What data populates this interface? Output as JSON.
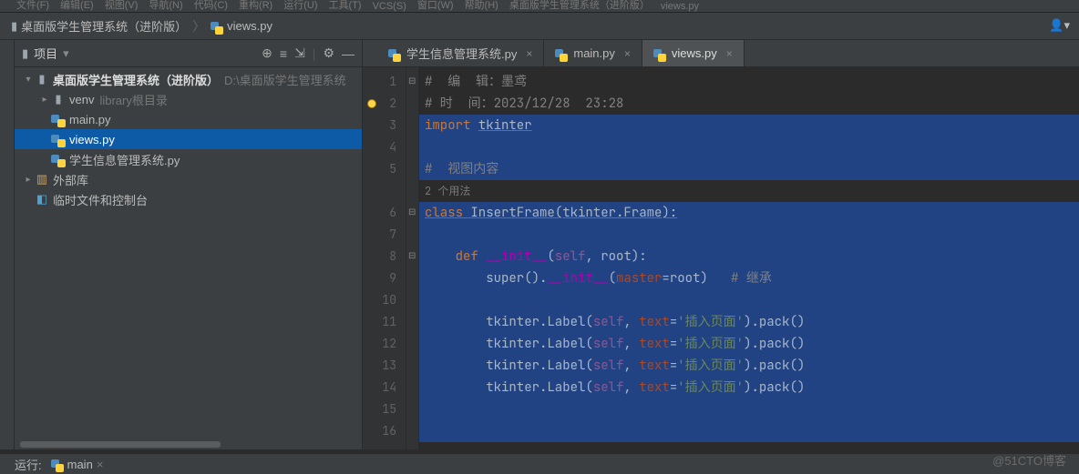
{
  "topmenu": [
    "文件(F)",
    "编辑(E)",
    "视图(V)",
    "导航(N)",
    "代码(C)",
    "重构(R)",
    "运行(U)",
    "工具(T)",
    "VCS(S)",
    "窗口(W)",
    "帮助(H)",
    "桌面版学生管理系统（进阶版）",
    "views.py"
  ],
  "breadcrumb": {
    "root": "桌面版学生管理系统（进阶版）",
    "file": "views.py"
  },
  "project_panel": {
    "title": "项目",
    "toolbar_icons": [
      "target-icon",
      "select-icon",
      "collapse-icon",
      "divider",
      "gear-icon",
      "minimize-icon"
    ],
    "tree": [
      {
        "type": "root",
        "label": "桌面版学生管理系统（进阶版）",
        "path": "D:\\桌面版学生管理系统"
      },
      {
        "type": "folder",
        "indent": 1,
        "label": "venv",
        "tag": "library根目录"
      },
      {
        "type": "py",
        "indent": 1,
        "label": "main.py"
      },
      {
        "type": "py",
        "indent": 1,
        "label": "views.py",
        "selected": true
      },
      {
        "type": "py",
        "indent": 1,
        "label": "学生信息管理系统.py"
      },
      {
        "type": "lib",
        "indent": 0,
        "label": "外部库"
      },
      {
        "type": "console",
        "indent": 0,
        "label": "临时文件和控制台"
      }
    ]
  },
  "toolbar": {
    "icons": [
      "target",
      "select",
      "expand",
      "divider",
      "gear",
      "minimize"
    ]
  },
  "tabs": [
    {
      "label": "学生信息管理系统.py",
      "active": false
    },
    {
      "label": "main.py",
      "active": false
    },
    {
      "label": "views.py",
      "active": true
    }
  ],
  "code": {
    "lines": [
      {
        "n": 1,
        "segments": [
          {
            "t": "#  编  辑：墨鸢",
            "c": "c-comment"
          }
        ]
      },
      {
        "n": 2,
        "bp": true,
        "segments": [
          {
            "t": "# 时  间：2023/12/28  23:28",
            "c": "c-comment"
          }
        ]
      },
      {
        "n": 3,
        "sel": true,
        "segments": [
          {
            "t": "import ",
            "c": "c-kw"
          },
          {
            "t": "tkinter",
            "c": "c-plain underline"
          }
        ]
      },
      {
        "n": 4,
        "sel": true,
        "segments": [
          {
            "t": "",
            "c": ""
          }
        ]
      },
      {
        "n": 5,
        "sel": true,
        "segments": [
          {
            "t": "#  视图内容",
            "c": "c-comment"
          }
        ]
      },
      {
        "usage": true,
        "segments": [
          {
            "t": "2 个用法",
            "c": "c-usage"
          }
        ]
      },
      {
        "n": 6,
        "sel": true,
        "segments": [
          {
            "t": "class ",
            "c": "c-kw underline"
          },
          {
            "t": "InsertFrame",
            "c": "c-class underline"
          },
          {
            "t": "(tkinter.Frame):",
            "c": "c-class underline"
          }
        ]
      },
      {
        "n": 7,
        "sel": true,
        "segments": [
          {
            "t": "",
            "c": ""
          }
        ]
      },
      {
        "n": 8,
        "sel": true,
        "segments": [
          {
            "t": "    ",
            "c": ""
          },
          {
            "t": "def ",
            "c": "c-kw"
          },
          {
            "t": "__init__",
            "c": "c-dunder"
          },
          {
            "t": "(",
            "c": "c-plain"
          },
          {
            "t": "self",
            "c": "c-self"
          },
          {
            "t": ", ",
            "c": "c-plain"
          },
          {
            "t": "root",
            "c": "c-plain"
          },
          {
            "t": "):",
            "c": "c-plain"
          }
        ]
      },
      {
        "n": 9,
        "sel": true,
        "segments": [
          {
            "t": "        ",
            "c": ""
          },
          {
            "t": "super().",
            "c": "c-plain"
          },
          {
            "t": "__init__",
            "c": "c-dunder"
          },
          {
            "t": "(",
            "c": "c-plain"
          },
          {
            "t": "master",
            "c": "c-named"
          },
          {
            "t": "=root)   ",
            "c": "c-plain"
          },
          {
            "t": "# 继承",
            "c": "c-comment"
          }
        ]
      },
      {
        "n": 10,
        "sel": true,
        "segments": [
          {
            "t": "",
            "c": ""
          }
        ]
      },
      {
        "n": 11,
        "sel": true,
        "segments": [
          {
            "t": "        tkinter.Label(",
            "c": "c-plain"
          },
          {
            "t": "self",
            "c": "c-self"
          },
          {
            "t": ", ",
            "c": "c-plain"
          },
          {
            "t": "text",
            "c": "c-named"
          },
          {
            "t": "=",
            "c": "c-plain"
          },
          {
            "t": "'插入页面'",
            "c": "c-str"
          },
          {
            "t": ").pack()",
            "c": "c-plain"
          }
        ]
      },
      {
        "n": 12,
        "sel": true,
        "segments": [
          {
            "t": "        tkinter.Label(",
            "c": "c-plain"
          },
          {
            "t": "self",
            "c": "c-self"
          },
          {
            "t": ", ",
            "c": "c-plain"
          },
          {
            "t": "text",
            "c": "c-named"
          },
          {
            "t": "=",
            "c": "c-plain"
          },
          {
            "t": "'插入页面'",
            "c": "c-str"
          },
          {
            "t": ").pack()",
            "c": "c-plain"
          }
        ]
      },
      {
        "n": 13,
        "sel": true,
        "segments": [
          {
            "t": "        tkinter.Label(",
            "c": "c-plain"
          },
          {
            "t": "self",
            "c": "c-self"
          },
          {
            "t": ", ",
            "c": "c-plain"
          },
          {
            "t": "text",
            "c": "c-named"
          },
          {
            "t": "=",
            "c": "c-plain"
          },
          {
            "t": "'插入页面'",
            "c": "c-str"
          },
          {
            "t": ").pack()",
            "c": "c-plain"
          }
        ]
      },
      {
        "n": 14,
        "sel": true,
        "segments": [
          {
            "t": "        tkinter.Label(",
            "c": "c-plain"
          },
          {
            "t": "self",
            "c": "c-self"
          },
          {
            "t": ", ",
            "c": "c-plain"
          },
          {
            "t": "text",
            "c": "c-named"
          },
          {
            "t": "=",
            "c": "c-plain"
          },
          {
            "t": "'插入页面'",
            "c": "c-str"
          },
          {
            "t": ").pack()",
            "c": "c-plain"
          }
        ]
      },
      {
        "n": 15,
        "sel": true,
        "segments": [
          {
            "t": "",
            "c": ""
          }
        ]
      },
      {
        "n": 16,
        "sel": true,
        "segments": [
          {
            "t": "",
            "c": ""
          }
        ]
      }
    ]
  },
  "run_bar": {
    "label": "运行:",
    "config": "main"
  },
  "watermark": "@51CTO博客"
}
